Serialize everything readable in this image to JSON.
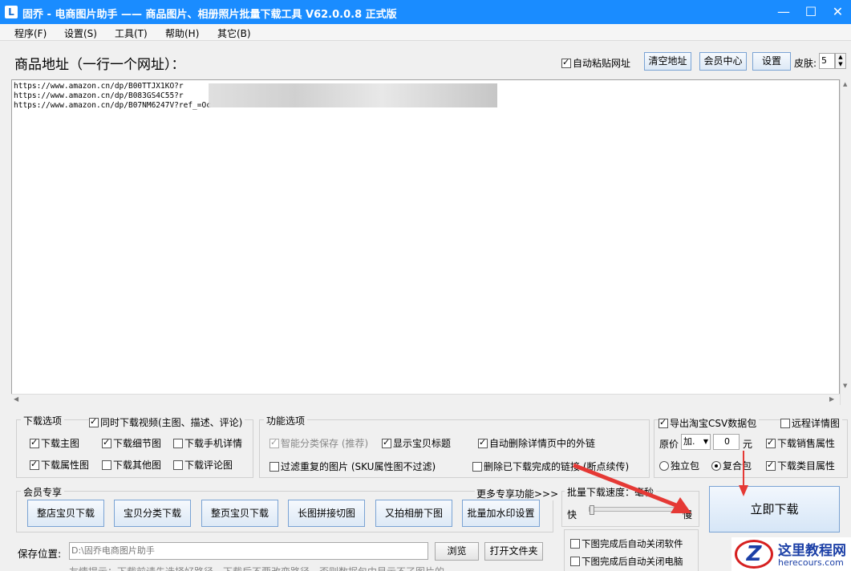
{
  "window": {
    "app_icon": "L",
    "title": "固乔 - 电商图片助手 —— 商品图片、相册照片批量下载工具 V62.0.0.8 正式版",
    "minimize": "—",
    "maximize": "☐",
    "close": "✕"
  },
  "menu": [
    "程序(F)",
    "设置(S)",
    "工具(T)",
    "帮助(H)",
    "其它(B)"
  ],
  "header": {
    "label": "商品地址（一行一个网址）：",
    "auto_paste": "自动粘贴网址",
    "clear_btn": "清空地址",
    "member_btn": "会员中心",
    "settings_btn": "设置",
    "skin_label": "皮肤:",
    "skin_value": "5"
  },
  "urls": [
    "https://www.amazon.cn/dp/B00TTJX1KO?r",
    "https://www.amazon.cn/dp/B083GS4C55?r",
    "https://www.amazon.cn/dp/B07NM6247V?ref_=Oc"
  ],
  "download_options": {
    "title": "下载选项",
    "video": "同时下载视频(主图、描述、评论)",
    "main_img": "下载主图",
    "detail_img": "下载细节图",
    "mobile_detail": "下载手机详情",
    "attr_img": "下载属性图",
    "other_img": "下载其他图",
    "review_img": "下载评论图"
  },
  "func_options": {
    "title": "功能选项",
    "smart_save": "智能分类保存 (推荐)",
    "show_title": "显示宝贝标题",
    "remove_links": "自动删除详情页中的外链",
    "filter_dup": "过滤重复的图片 (SKU属性图不过滤)",
    "remove_done": "删除已下载完成的链接 (断点续传)"
  },
  "right_options": {
    "export_csv": "导出淘宝CSV数据包",
    "remote_detail": "远程详情图",
    "price_label": "原价",
    "price_op": "加.",
    "price_value": "0",
    "price_unit": "元",
    "sales_attr": "下载销售属性",
    "single_pkg": "独立包",
    "combo_pkg": "复合包",
    "category_attr": "下载类目属性"
  },
  "member": {
    "title": "会员专享",
    "more": "更多专享功能>>>",
    "buttons": [
      "整店宝贝下载",
      "宝贝分类下载",
      "整页宝贝下载",
      "长图拼接切图",
      "又拍相册下图",
      "批量加水印设置"
    ]
  },
  "speed": {
    "title": "批量下载速度：",
    "unit": "毫秒",
    "fast": "快",
    "slow": "慢",
    "value_fraction": 0.0
  },
  "after": {
    "close_app": "下图完成后自动关闭软件",
    "shutdown": "下图完成后自动关闭电脑"
  },
  "save": {
    "label": "保存位置:",
    "path": "D:\\固乔电商图片助手",
    "browse": "浏览",
    "open_folder": "打开文件夹",
    "tip": "友情提示：下载前请先选择好路径，下载后不要改变路径，否则数据包中显示不了图片的。"
  },
  "download_btn": "立即下载",
  "watermark": {
    "logo": "Z",
    "cn": "这里教程网",
    "en": "herecours.com"
  },
  "colors": {
    "titlebar": "#1a8cff",
    "arrow": "#e53935"
  }
}
